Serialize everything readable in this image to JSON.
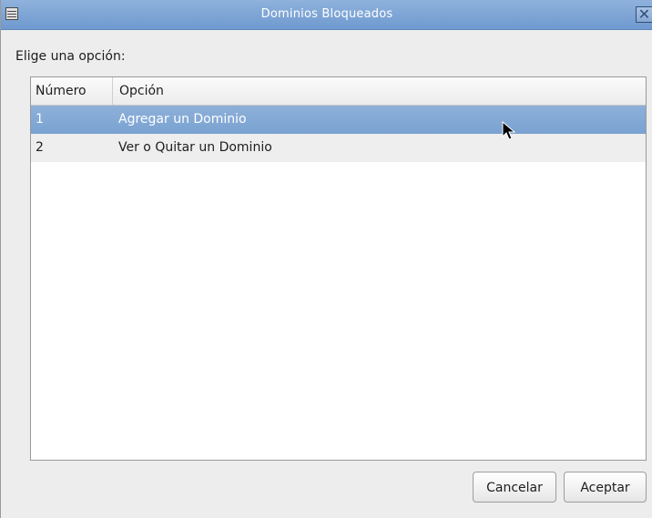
{
  "window": {
    "title": "Dominios Bloqueados",
    "close_glyph": "✕"
  },
  "prompt": "Elige una opción:",
  "table": {
    "columns": [
      "Número",
      "Opción"
    ],
    "rows": [
      {
        "number": "1",
        "option": "Agregar un Dominio",
        "selected": true
      },
      {
        "number": "2",
        "option": "Ver o Quitar un Dominio",
        "selected": false
      }
    ]
  },
  "buttons": {
    "cancel": "Cancelar",
    "ok": "Aceptar"
  },
  "colors": {
    "titlebar": "#7aa2d1",
    "selection": "#7fa6d4"
  },
  "icons": {
    "window_menu": "window-menu-icon",
    "close": "close-icon",
    "cursor": "mouse-pointer-icon"
  }
}
